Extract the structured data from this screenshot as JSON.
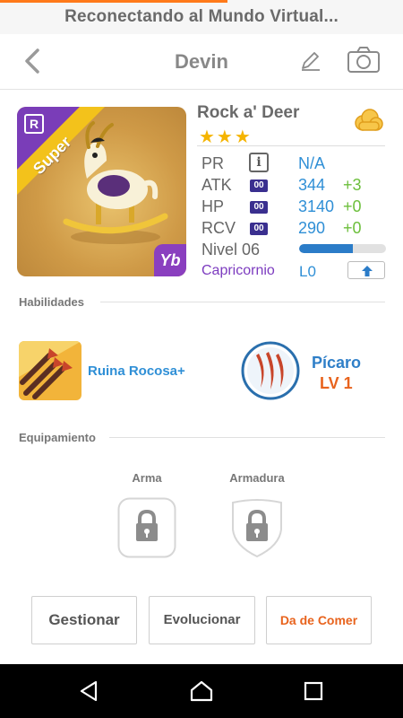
{
  "status": {
    "text": "Reconectando al Mundo Virtual..."
  },
  "header": {
    "title": "Devin"
  },
  "card": {
    "rarity": "R",
    "tier_label": "Super",
    "element": "Yb"
  },
  "monster": {
    "name": "Rock a' Deer",
    "stars": "★★★",
    "stats": [
      {
        "label": "PR",
        "value": "N/A",
        "plus": ""
      },
      {
        "label": "ATK",
        "tag": "00",
        "value": "344",
        "plus": "+3"
      },
      {
        "label": "HP",
        "tag": "00",
        "value": "3140",
        "plus": "+0"
      },
      {
        "label": "RCV",
        "tag": "00",
        "value": "290",
        "plus": "+0"
      }
    ],
    "level_label": "Nivel 06",
    "level_progress": 0.62,
    "constellation": "Capricornio",
    "constellation_level": "L0"
  },
  "abilities": {
    "title": "Habilidades",
    "skill_name": "Ruina Rocosa+",
    "class_name": "Pícaro",
    "class_level": "LV 1"
  },
  "equipment": {
    "title": "Equipamiento",
    "weapon_label": "Arma",
    "armor_label": "Armadura"
  },
  "actions": {
    "manage": "Gestionar",
    "evolve": "Evolucionar",
    "feed": "Da de Comer"
  },
  "colors": {
    "accent_orange": "#e8631d",
    "link_blue": "#2f8fd6",
    "purple": "#7c3bbf",
    "star_gold": "#f5b400"
  },
  "icons": {
    "back": "chevron-left-icon",
    "edit": "pencil-icon",
    "camera": "camera-icon",
    "cloud": "cloud-currency-icon",
    "info": "info-icon",
    "upgrade": "arrow-up-icon",
    "lock": "lock-icon",
    "nav_back": "triangle-back-icon",
    "nav_home": "home-icon",
    "nav_recent": "square-recent-icon"
  }
}
